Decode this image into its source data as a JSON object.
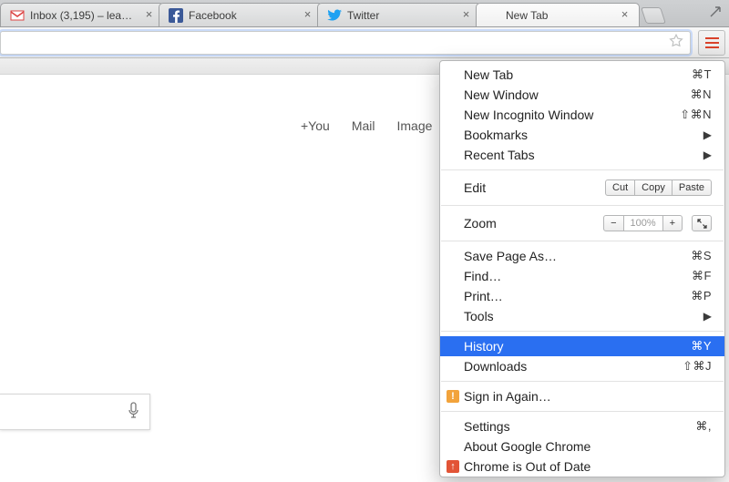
{
  "tabs": [
    {
      "title": "Inbox (3,195) – lea…",
      "icon": "gmail"
    },
    {
      "title": "Facebook",
      "icon": "facebook"
    },
    {
      "title": "Twitter",
      "icon": "twitter"
    },
    {
      "title": "New Tab",
      "icon": "none",
      "active": true
    }
  ],
  "omnibox": {
    "value": ""
  },
  "page_nav": {
    "plus_you": "+You",
    "mail": "Mail",
    "images": "Image"
  },
  "menu": {
    "new_tab": {
      "label": "New Tab",
      "shortcut": "⌘T"
    },
    "new_window": {
      "label": "New Window",
      "shortcut": "⌘N"
    },
    "new_incognito": {
      "label": "New Incognito Window",
      "shortcut": "⇧⌘N"
    },
    "bookmarks": {
      "label": "Bookmarks"
    },
    "recent_tabs": {
      "label": "Recent Tabs"
    },
    "edit": {
      "label": "Edit",
      "cut": "Cut",
      "copy": "Copy",
      "paste": "Paste"
    },
    "zoom": {
      "label": "Zoom",
      "value": "100%",
      "minus": "−",
      "plus": "+"
    },
    "save_as": {
      "label": "Save Page As…",
      "shortcut": "⌘S"
    },
    "find": {
      "label": "Find…",
      "shortcut": "⌘F"
    },
    "print": {
      "label": "Print…",
      "shortcut": "⌘P"
    },
    "tools": {
      "label": "Tools"
    },
    "history": {
      "label": "History",
      "shortcut": "⌘Y"
    },
    "downloads": {
      "label": "Downloads",
      "shortcut": "⇧⌘J"
    },
    "sign_in": {
      "label": "Sign in Again…"
    },
    "settings": {
      "label": "Settings",
      "shortcut": "⌘,"
    },
    "about": {
      "label": "About Google Chrome"
    },
    "out_of_date": {
      "label": "Chrome is Out of Date"
    }
  }
}
